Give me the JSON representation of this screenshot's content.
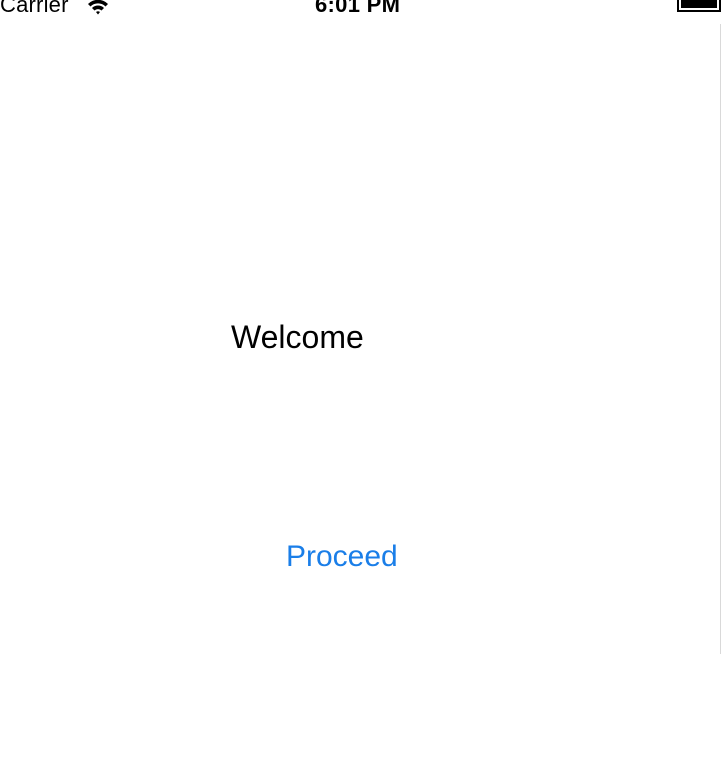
{
  "status_bar": {
    "carrier": "Carrier",
    "time": "6:01 PM",
    "wifi_icon": "wifi-icon",
    "battery_icon": "battery-icon"
  },
  "main": {
    "welcome_text": "Welcome",
    "proceed_label": "Proceed"
  },
  "colors": {
    "background": "#ffffff",
    "text": "#000000",
    "accent": "#1a7ee8"
  }
}
